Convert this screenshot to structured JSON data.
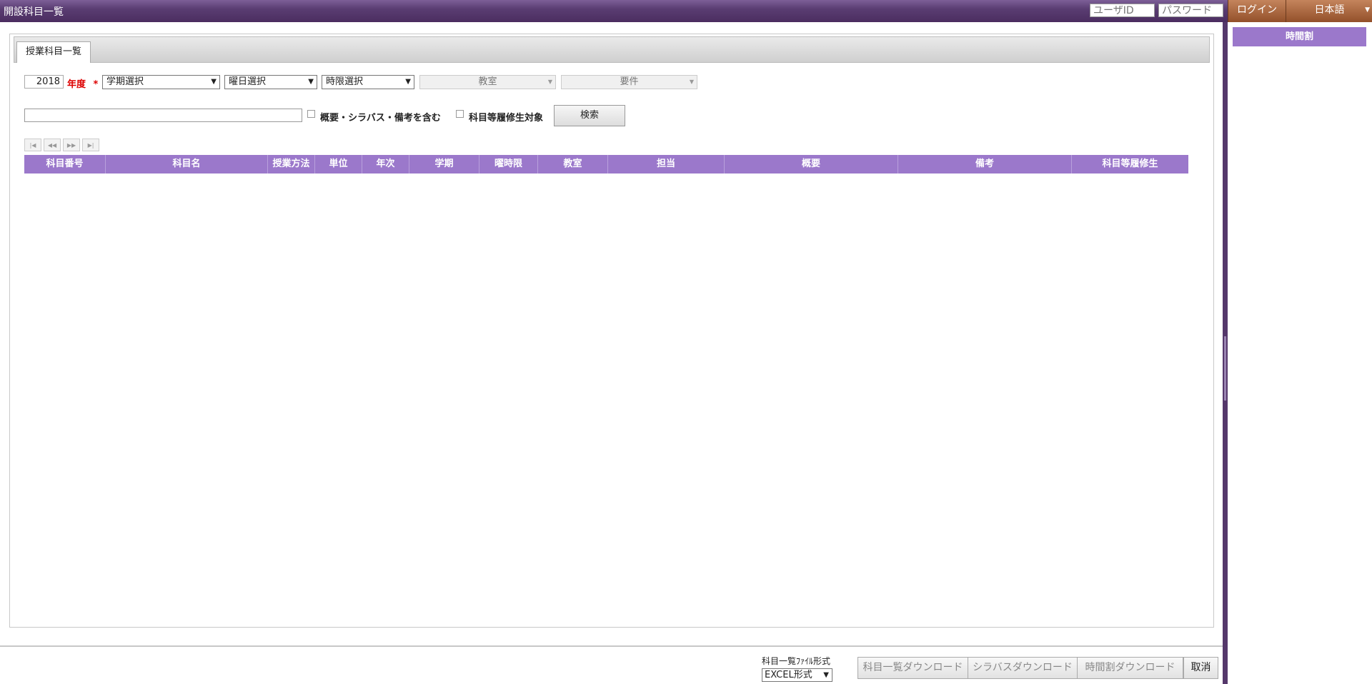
{
  "header": {
    "title": "開設科目一覧",
    "user_id_placeholder": "ユーザID",
    "password_placeholder": "パスワード",
    "login_label": "ログイン",
    "language_label": "日本語"
  },
  "right_panel": {
    "timetable_label": "時間割"
  },
  "tabs": [
    {
      "label": "授業科目一覧"
    }
  ],
  "filters": {
    "year_value": "2018",
    "year_label": "年度",
    "required_mark": "*",
    "term_select": "学期選択",
    "day_select": "曜日選択",
    "period_select": "時限選択",
    "classroom_select": "教室",
    "requirement_select": "要件"
  },
  "search": {
    "keyword_value": "",
    "include_syllabus_label": "概要・シラバス・備考を含む",
    "equivalent_course_label": "科目等履修生対象",
    "search_button": "検索"
  },
  "pager": {
    "first": "|◀",
    "prev": "◀◀",
    "next": "▶▶",
    "last": "▶|"
  },
  "grid": {
    "columns": [
      "科目番号",
      "科目名",
      "授業方法",
      "単位",
      "年次",
      "学期",
      "曜時限",
      "教室",
      "担当",
      "概要",
      "備考",
      "科目等履修生"
    ]
  },
  "footer": {
    "file_format_label": "科目一覧ﾌｧｲﾙ形式",
    "file_format_value": "EXCEL形式",
    "download_list_button": "科目一覧ダウンロード",
    "download_syllabus_button": "シラバスダウンロード",
    "download_timetable_button": "時間割ダウンロード",
    "cancel_button": "取消"
  }
}
